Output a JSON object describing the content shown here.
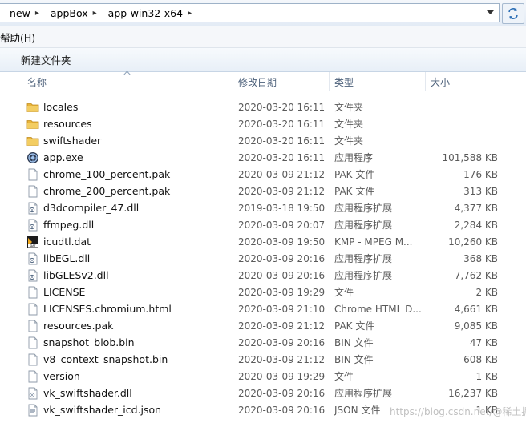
{
  "address": {
    "crumbs": [
      "new",
      "appBox",
      "app-win32-x64"
    ],
    "separator": "▸"
  },
  "menu": {
    "items": [
      "帮助(H)"
    ]
  },
  "toolbar": {
    "new_folder_label": "新建文件夹"
  },
  "columns": {
    "name": "名称",
    "date": "修改日期",
    "type": "类型",
    "size": "大小"
  },
  "files": [
    {
      "name": "locales",
      "date": "2020-03-20 16:11",
      "type": "文件夹",
      "size": "",
      "icon": "folder"
    },
    {
      "name": "resources",
      "date": "2020-03-20 16:11",
      "type": "文件夹",
      "size": "",
      "icon": "folder"
    },
    {
      "name": "swiftshader",
      "date": "2020-03-20 16:11",
      "type": "文件夹",
      "size": "",
      "icon": "folder"
    },
    {
      "name": "app.exe",
      "date": "2020-03-20 16:11",
      "type": "应用程序",
      "size": "101,588 KB",
      "icon": "exe"
    },
    {
      "name": "chrome_100_percent.pak",
      "date": "2020-03-09 21:12",
      "type": "PAK 文件",
      "size": "176 KB",
      "icon": "file"
    },
    {
      "name": "chrome_200_percent.pak",
      "date": "2020-03-09 21:12",
      "type": "PAK 文件",
      "size": "313 KB",
      "icon": "file"
    },
    {
      "name": "d3dcompiler_47.dll",
      "date": "2019-03-18 19:50",
      "type": "应用程序扩展",
      "size": "4,377 KB",
      "icon": "dll"
    },
    {
      "name": "ffmpeg.dll",
      "date": "2020-03-09 20:07",
      "type": "应用程序扩展",
      "size": "2,284 KB",
      "icon": "dll"
    },
    {
      "name": "icudtl.dat",
      "date": "2020-03-09 19:50",
      "type": "KMP - MPEG M...",
      "size": "10,260 KB",
      "icon": "dat"
    },
    {
      "name": "libEGL.dll",
      "date": "2020-03-09 20:16",
      "type": "应用程序扩展",
      "size": "368 KB",
      "icon": "dll"
    },
    {
      "name": "libGLESv2.dll",
      "date": "2020-03-09 20:16",
      "type": "应用程序扩展",
      "size": "7,762 KB",
      "icon": "dll"
    },
    {
      "name": "LICENSE",
      "date": "2020-03-09 19:29",
      "type": "文件",
      "size": "2 KB",
      "icon": "file"
    },
    {
      "name": "LICENSES.chromium.html",
      "date": "2020-03-09 21:10",
      "type": "Chrome HTML D...",
      "size": "4,661 KB",
      "icon": "file"
    },
    {
      "name": "resources.pak",
      "date": "2020-03-09 21:12",
      "type": "PAK 文件",
      "size": "9,085 KB",
      "icon": "file"
    },
    {
      "name": "snapshot_blob.bin",
      "date": "2020-03-09 20:16",
      "type": "BIN 文件",
      "size": "47 KB",
      "icon": "file"
    },
    {
      "name": "v8_context_snapshot.bin",
      "date": "2020-03-09 21:12",
      "type": "BIN 文件",
      "size": "608 KB",
      "icon": "file"
    },
    {
      "name": "version",
      "date": "2020-03-09 19:29",
      "type": "文件",
      "size": "1 KB",
      "icon": "file"
    },
    {
      "name": "vk_swiftshader.dll",
      "date": "2020-03-09 20:16",
      "type": "应用程序扩展",
      "size": "16,237 KB",
      "icon": "dll"
    },
    {
      "name": "vk_swiftshader_icd.json",
      "date": "2020-03-09 20:16",
      "type": "JSON 文件",
      "size": "1 KB",
      "icon": "json"
    }
  ],
  "watermark": "https://blog.csdn.net/@稀土掘金技术社区",
  "colors": {
    "folder": "#e8b43a",
    "header_text": "#4c607a",
    "meta_text": "#5a5a5a"
  }
}
